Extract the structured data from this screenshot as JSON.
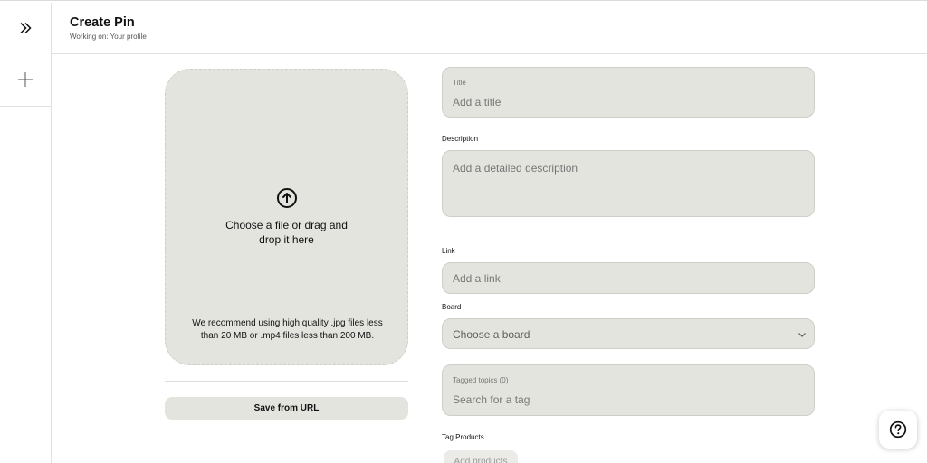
{
  "header": {
    "title": "Create Pin",
    "subtitle": "Working on: Your profile"
  },
  "sidebar": {
    "items": [
      {
        "name": "expand",
        "icon": "double-chevron-right-icon"
      },
      {
        "name": "create",
        "icon": "plus-icon"
      }
    ]
  },
  "upload": {
    "icon": "arrow-up-circle-icon",
    "line1": "Choose a file or drag and",
    "line2": "drop it here",
    "note_line1": "We recommend using high quality .jpg files less",
    "note_line2": "than 20 MB or .mp4 files less than 200 MB."
  },
  "save_url_label": "Save from URL",
  "form": {
    "title_label": "Title",
    "title_placeholder": "Add a title",
    "description_label": "Description",
    "description_placeholder": "Add a detailed description",
    "link_label": "Link",
    "link_placeholder": "Add a link",
    "board_label": "Board",
    "board_value": "Choose a board",
    "tags_label": "Tagged topics (0)",
    "tags_placeholder": "Search for a tag",
    "products_label": "Tag Products",
    "add_products_label": "Add products"
  },
  "help": {
    "icon": "question-circle-icon"
  },
  "colors": {
    "field_bg": "#e4e4df",
    "field_border": "#cfcfc9",
    "placeholder": "#767676",
    "text": "#111111"
  }
}
